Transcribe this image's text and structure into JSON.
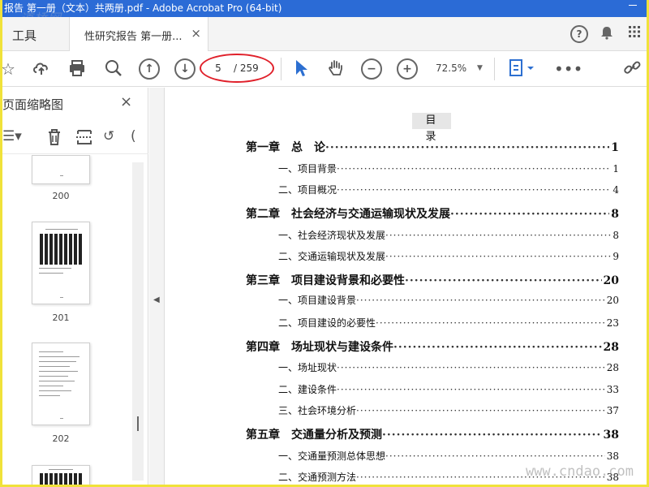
{
  "window": {
    "title": "报告 第一册（文本）共两册.pdf - Adobe Acrobat Pro (64-bit)"
  },
  "watermarks": {
    "top_left": "道桥网",
    "bottom_right": "www.cndao.com"
  },
  "tabbar": {
    "tools_label": "工具",
    "tab_label": "性研究报告 第一册...",
    "close": "×",
    "help": "?"
  },
  "toolbar": {
    "current_page": "5",
    "total_pages": "/ 259",
    "zoom": "72.5%",
    "zoom_caret": "▼"
  },
  "icons": [
    "star-icon",
    "upload-icon",
    "print-icon",
    "zoom-search-icon",
    "page-up-icon",
    "page-down-icon",
    "select-cursor-icon",
    "hand-icon",
    "zoom-out-icon",
    "zoom-in-icon",
    "page-fit-icon",
    "more-icon",
    "link-share-icon"
  ],
  "panel": {
    "title": "页面缩略图",
    "close": "×",
    "thumbnails": [
      {
        "number": "200"
      },
      {
        "number": "201"
      },
      {
        "number": "202"
      }
    ]
  },
  "toc": {
    "title": "目 录",
    "entries": [
      {
        "level": "chapter",
        "label": "第一章　总　论",
        "page": "1"
      },
      {
        "level": "section",
        "label": "一、项目背景",
        "page": "1"
      },
      {
        "level": "section",
        "label": "二、项目概况",
        "page": "4"
      },
      {
        "level": "chapter",
        "label": "第二章　社会经济与交通运输现状及发展",
        "page": "8"
      },
      {
        "level": "section",
        "label": "一、社会经济现状及发展",
        "page": "8"
      },
      {
        "level": "section",
        "label": "二、交通运输现状及发展",
        "page": "9"
      },
      {
        "level": "chapter",
        "label": "第三章　项目建设背景和必要性",
        "page": "20"
      },
      {
        "level": "section",
        "label": "一、项目建设背景",
        "page": "20"
      },
      {
        "level": "section",
        "label": "二、项目建设的必要性",
        "page": "23"
      },
      {
        "level": "chapter",
        "label": "第四章　场址现状与建设条件",
        "page": "28"
      },
      {
        "level": "section",
        "label": "一、场址现状",
        "page": "28"
      },
      {
        "level": "section",
        "label": "二、建设条件",
        "page": "33"
      },
      {
        "level": "section",
        "label": "三、社会环境分析",
        "page": "37"
      },
      {
        "level": "chapter",
        "label": "第五章　交通量分析及预测",
        "page": "38"
      },
      {
        "level": "section",
        "label": "一、交通量预测总体思想",
        "page": "38"
      },
      {
        "level": "section",
        "label": "二、交通预测方法",
        "page": "38"
      }
    ]
  }
}
